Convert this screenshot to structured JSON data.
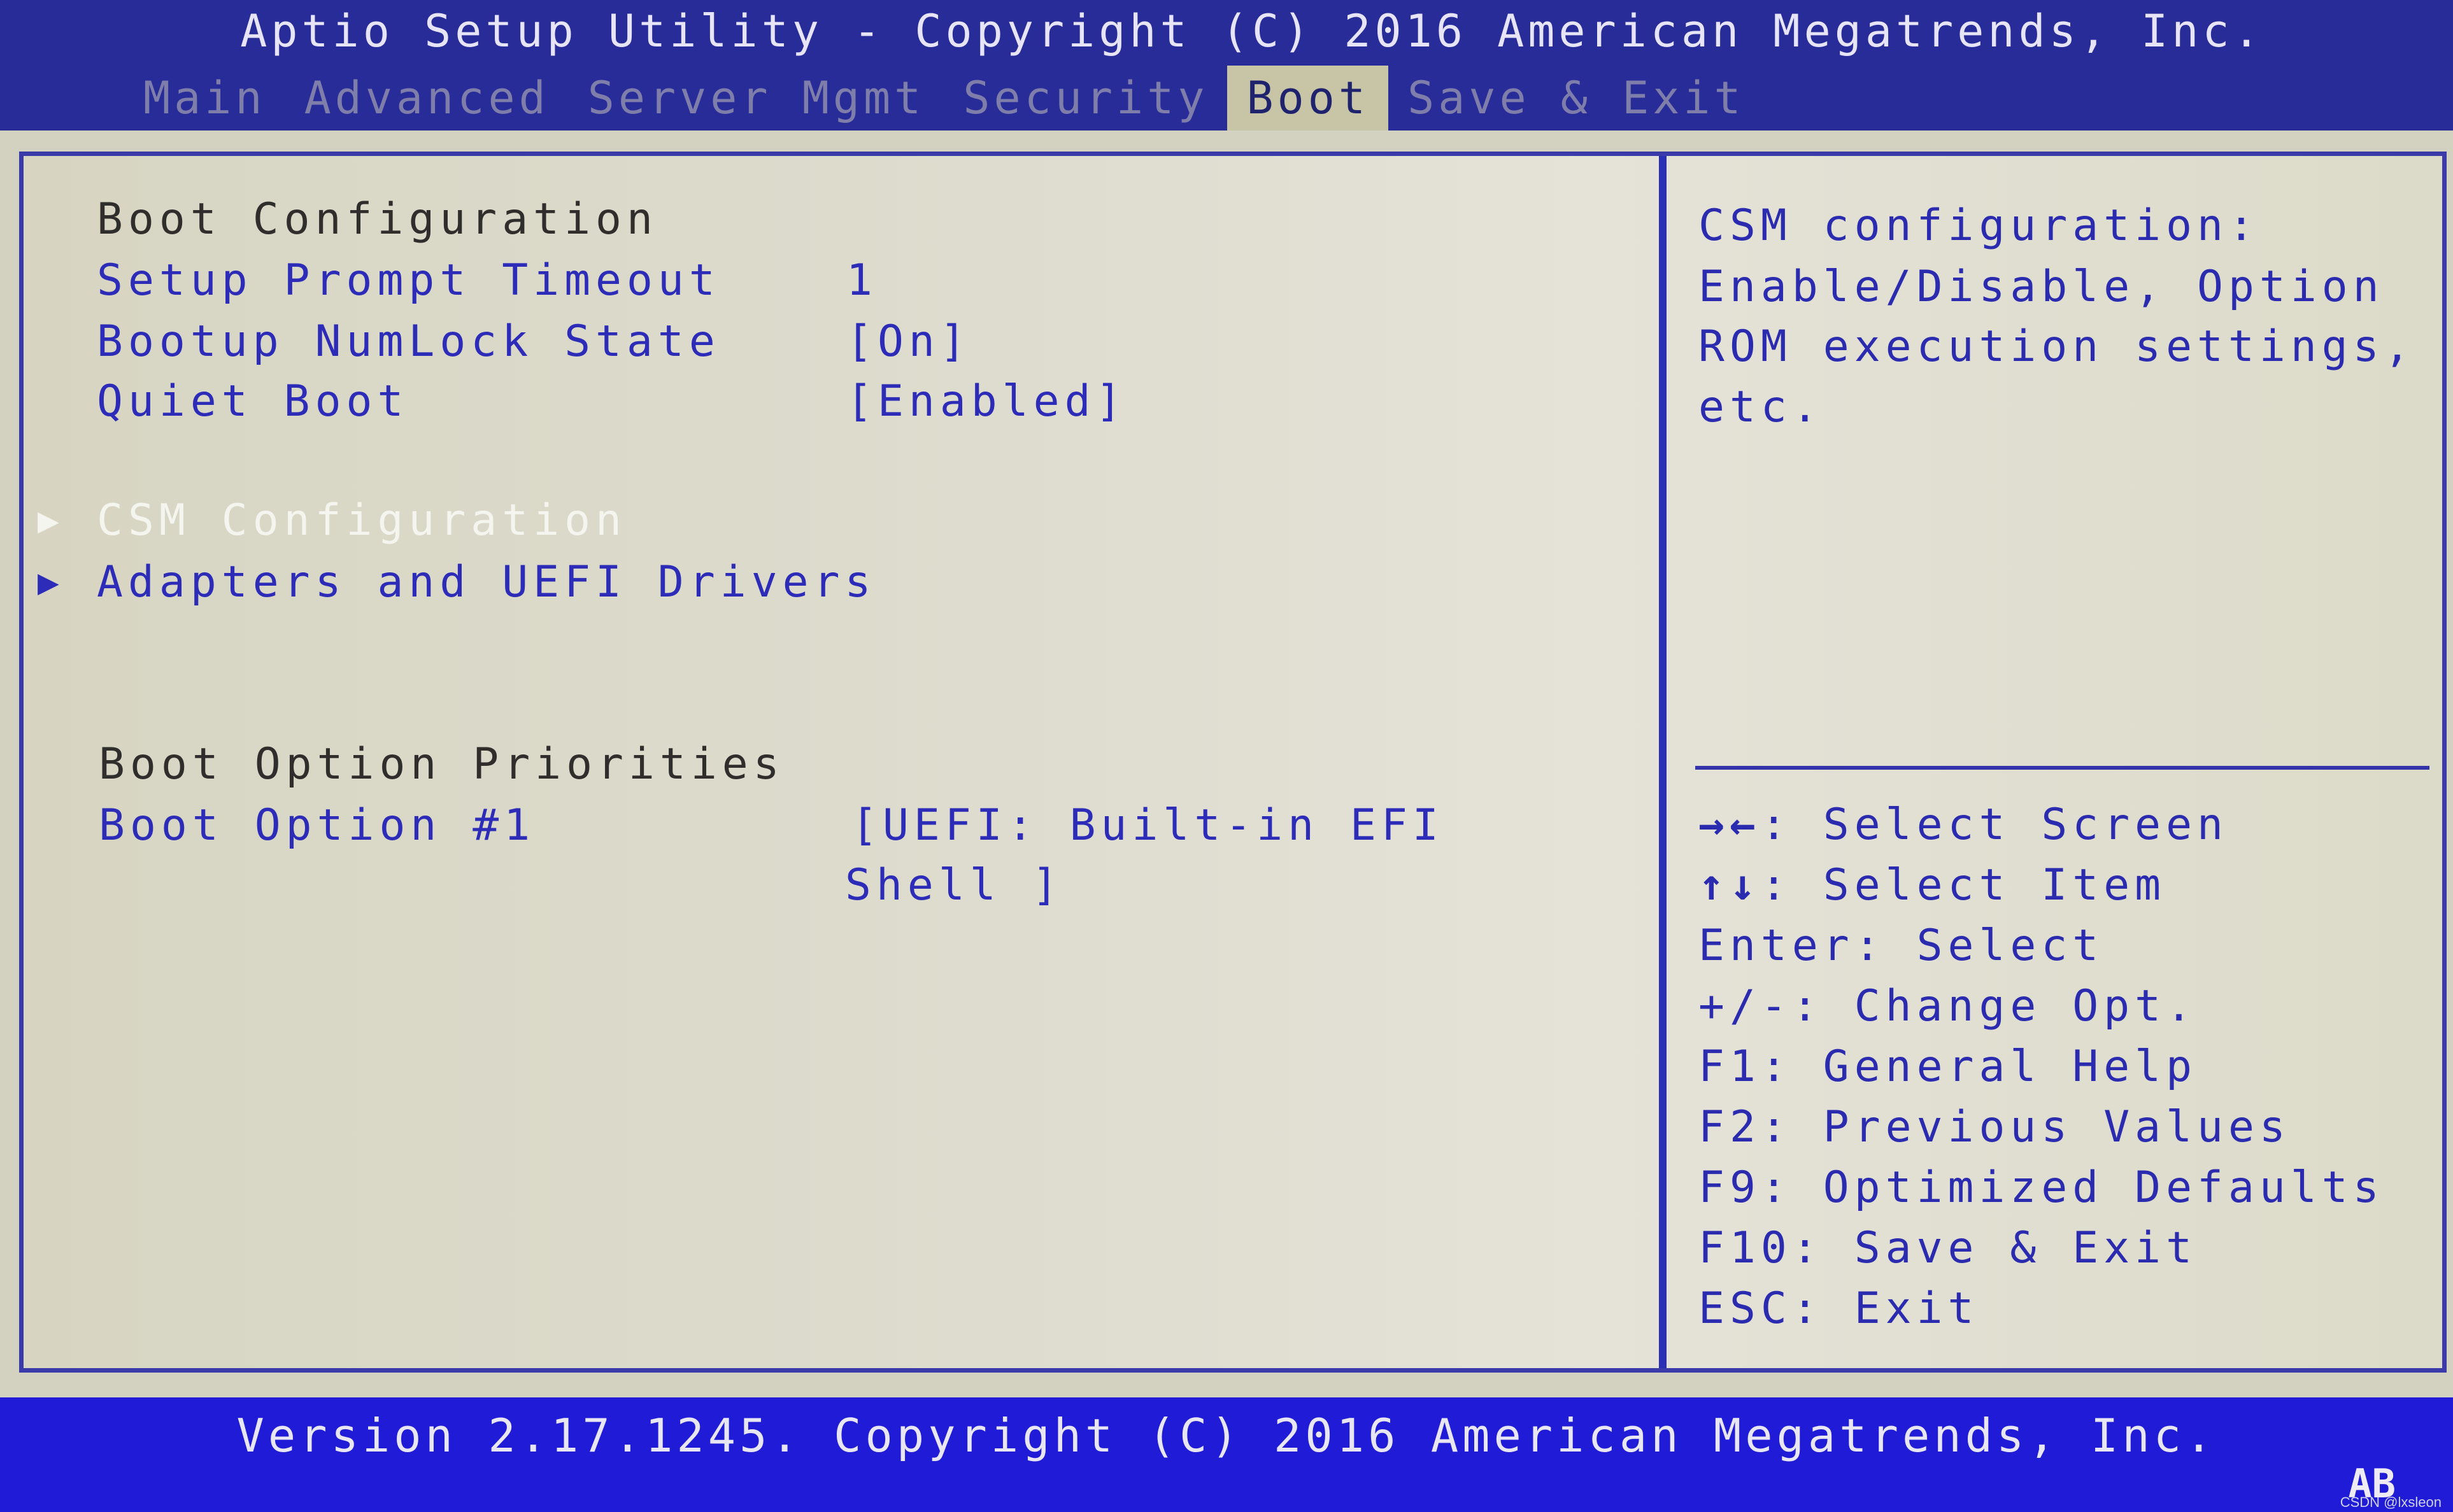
{
  "header": {
    "title": "Aptio Setup Utility - Copyright (C) 2016 American Megatrends, Inc.",
    "tabs": [
      {
        "label": "Main",
        "active": false
      },
      {
        "label": "Advanced",
        "active": false
      },
      {
        "label": "Server Mgmt",
        "active": false
      },
      {
        "label": "Security",
        "active": false
      },
      {
        "label": "Boot",
        "active": true
      },
      {
        "label": "Save & Exit",
        "active": false
      }
    ]
  },
  "main": {
    "section_boot_config": "Boot Configuration",
    "settings": [
      {
        "label": "Setup Prompt Timeout",
        "value": "1"
      },
      {
        "label": "Bootup NumLock State",
        "value": "[On]"
      },
      {
        "label": "Quiet Boot",
        "value": "[Enabled]"
      }
    ],
    "submenus": [
      {
        "label": "CSM Configuration",
        "selected": true,
        "icon": "triangle-right-icon"
      },
      {
        "label": "Adapters and UEFI Drivers",
        "selected": false,
        "icon": "triangle-right-icon"
      }
    ],
    "section_priorities": "Boot Option Priorities",
    "boot_options": [
      {
        "label": "Boot Option #1",
        "value_line1": "[UEFI: Built-in EFI",
        "value_line2": "Shell ]"
      }
    ]
  },
  "help": {
    "description": [
      "CSM configuration:",
      "Enable/Disable, Option",
      "ROM execution settings,",
      "etc."
    ],
    "keys": [
      {
        "key": "→←",
        "icon": "left-right-arrows-icon",
        "action": ": Select Screen"
      },
      {
        "key": "↑↓",
        "icon": "up-down-arrows-icon",
        "action": ": Select Item"
      },
      {
        "key": "Enter",
        "action": ": Select"
      },
      {
        "key": "+/-",
        "action": ": Change Opt."
      },
      {
        "key": "F1",
        "action": ": General Help"
      },
      {
        "key": "F2",
        "action": ": Previous Values"
      },
      {
        "key": "F9",
        "action": ": Optimized Defaults"
      },
      {
        "key": "F10",
        "action": ": Save & Exit"
      },
      {
        "key": "ESC",
        "action": ": Exit"
      }
    ]
  },
  "footer": {
    "version": "Version 2.17.1245. Copyright (C) 2016 American Megatrends, Inc.",
    "badge": "AB",
    "watermark": "CSDN @lxsleon"
  },
  "colors": {
    "header_bg": "#272c98",
    "footer_bg": "#1f1bd6",
    "panel_bg": "#d7d5c2",
    "item_blue": "#2c2cb8",
    "selected_white": "#f5f5f0",
    "active_tab_bg": "#c8c4a6"
  }
}
